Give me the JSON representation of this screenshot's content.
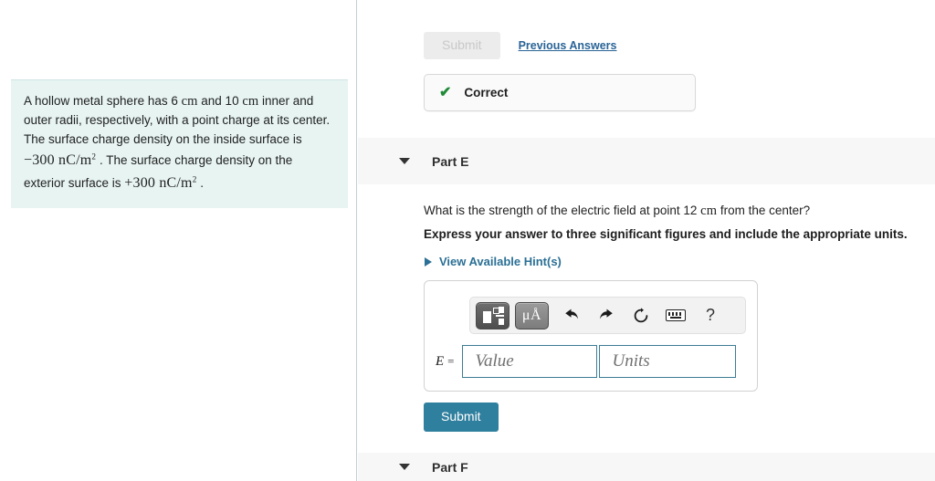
{
  "left_panel": {
    "problem_text_parts": {
      "line1": "A hollow metal sphere has 6 ",
      "unit_cm_a": "cm",
      "line1b": " and 10 ",
      "unit_cm_b": "cm",
      "line1c": " inner and outer radii, respectively, with a point charge at its center. The surface charge density on the inside surface is ",
      "sigma_inner": "−300 nC/m",
      "sigma_inner_exp": "2",
      "line2": " . The surface charge density on the exterior surface is ",
      "sigma_outer": "+300 nC/m",
      "sigma_outer_exp": "2",
      "line3": " ."
    }
  },
  "top_bar": {
    "submit_disabled_label": "Submit",
    "previous_answers_label": "Previous Answers"
  },
  "feedback": {
    "check_icon": "check-icon",
    "status_label": "Correct"
  },
  "part_e": {
    "caret_icon": "chevron-down-icon",
    "title": "Part E",
    "question_prefix": "What is the strength of the electric field at point 12 ",
    "question_unit": "cm",
    "question_suffix": " from the center?",
    "instruction": "Express your answer to three significant figures and include the appropriate units.",
    "hints_label": "View Available Hint(s)",
    "hints_caret_icon": "chevron-right-icon",
    "toolbar": {
      "template_button": "math-template-icon",
      "units_button": "μÅ",
      "undo_button": "⮌",
      "redo_button": "⮍",
      "reset_button": "↻",
      "keyboard_button": "keyboard-icon",
      "help_button": "?"
    },
    "answer": {
      "variable": "E",
      "equals": "=",
      "value_placeholder": "Value",
      "units_placeholder": "Units",
      "value": "",
      "units": ""
    },
    "submit_label": "Submit"
  },
  "part_f": {
    "caret_icon": "chevron-down-icon",
    "title": "Part F"
  },
  "colors": {
    "accent_blue": "#2f7f9e",
    "link_blue": "#2b7095",
    "correct_green": "#1f8a38",
    "problem_bg": "#e7f4f2",
    "part_header_bg": "#f7f7f7"
  }
}
